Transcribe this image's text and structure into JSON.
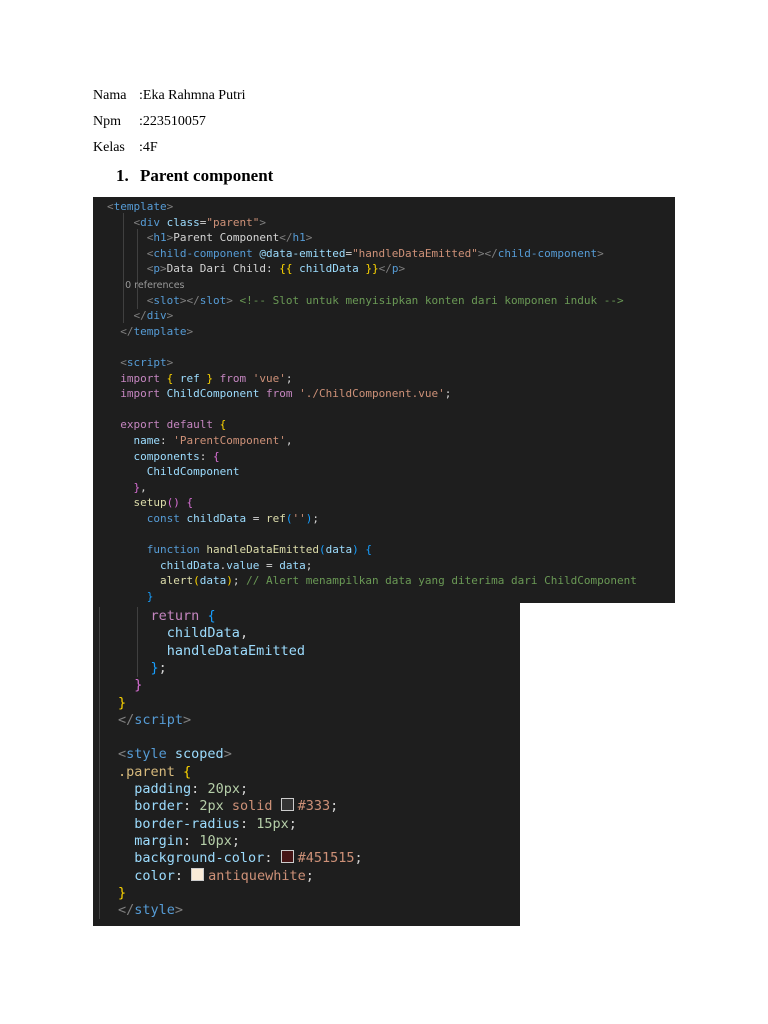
{
  "student": {
    "nama_label": "Nama",
    "nama_value": ":Eka Rahmna Putri",
    "npm_label": "Npm",
    "npm_value": ":223510057",
    "kelas_label": "Kelas",
    "kelas_value": ":4F"
  },
  "section": {
    "number": "1.",
    "title": "Parent component"
  },
  "code_top": {
    "lines": [
      [
        [
          "g",
          "<"
        ],
        [
          "t",
          "template"
        ],
        [
          "g",
          ">"
        ]
      ],
      [
        [
          "w",
          "    "
        ],
        [
          "g",
          "<"
        ],
        [
          "t",
          "div"
        ],
        [
          "w",
          " "
        ],
        [
          "a",
          "class"
        ],
        [
          "w",
          "="
        ],
        [
          "s",
          "\"parent\""
        ],
        [
          "g",
          ">"
        ]
      ],
      [
        [
          "w",
          "      "
        ],
        [
          "g",
          "<"
        ],
        [
          "t",
          "h1"
        ],
        [
          "g",
          ">"
        ],
        [
          "w",
          "Parent Component"
        ],
        [
          "g",
          "</"
        ],
        [
          "t",
          "h1"
        ],
        [
          "g",
          ">"
        ]
      ],
      [
        [
          "w",
          "      "
        ],
        [
          "g",
          "<"
        ],
        [
          "t",
          "child-component"
        ],
        [
          "w",
          " "
        ],
        [
          "a",
          "@data-emitted"
        ],
        [
          "w",
          "="
        ],
        [
          "s",
          "\"handleDataEmitted\""
        ],
        [
          "g",
          "></"
        ],
        [
          "t",
          "child-component"
        ],
        [
          "g",
          ">"
        ]
      ],
      [
        [
          "w",
          "      "
        ],
        [
          "g",
          "<"
        ],
        [
          "t",
          "p"
        ],
        [
          "g",
          ">"
        ],
        [
          "w",
          "Data Dari Child: "
        ],
        [
          "y",
          "{{"
        ],
        [
          "w",
          " "
        ],
        [
          "a",
          "childData"
        ],
        [
          "w",
          " "
        ],
        [
          "y",
          "}}"
        ],
        [
          "g",
          "</"
        ],
        [
          "t",
          "p"
        ],
        [
          "g",
          ">"
        ]
      ],
      [
        [
          "ref",
          "      0 references"
        ]
      ],
      [
        [
          "w",
          "      "
        ],
        [
          "g",
          "<"
        ],
        [
          "t",
          "slot"
        ],
        [
          "g",
          "></"
        ],
        [
          "t",
          "slot"
        ],
        [
          "g",
          ">"
        ],
        [
          "w",
          " "
        ],
        [
          "c",
          "<!-- Slot untuk menyisipkan konten dari komponen induk -->"
        ]
      ],
      [
        [
          "w",
          "    "
        ],
        [
          "g",
          "</"
        ],
        [
          "t",
          "div"
        ],
        [
          "g",
          ">"
        ]
      ],
      [
        [
          "w",
          "  "
        ],
        [
          "g",
          "</"
        ],
        [
          "t",
          "template"
        ],
        [
          "g",
          ">"
        ]
      ],
      [],
      [
        [
          "w",
          "  "
        ],
        [
          "g",
          "<"
        ],
        [
          "t",
          "script"
        ],
        [
          "g",
          ">"
        ]
      ],
      [
        [
          "w",
          "  "
        ],
        [
          "k",
          "import"
        ],
        [
          "w",
          " "
        ],
        [
          "y",
          "{"
        ],
        [
          "w",
          " "
        ],
        [
          "a",
          "ref"
        ],
        [
          "w",
          " "
        ],
        [
          "y",
          "}"
        ],
        [
          "w",
          " "
        ],
        [
          "k",
          "from"
        ],
        [
          "w",
          " "
        ],
        [
          "s",
          "'vue'"
        ],
        [
          "w",
          ";"
        ]
      ],
      [
        [
          "w",
          "  "
        ],
        [
          "k",
          "import"
        ],
        [
          "w",
          " "
        ],
        [
          "a",
          "ChildComponent"
        ],
        [
          "w",
          " "
        ],
        [
          "k",
          "from"
        ],
        [
          "w",
          " "
        ],
        [
          "s",
          "'./ChildComponent.vue'"
        ],
        [
          "w",
          ";"
        ]
      ],
      [],
      [
        [
          "w",
          "  "
        ],
        [
          "k",
          "export"
        ],
        [
          "w",
          " "
        ],
        [
          "k",
          "default"
        ],
        [
          "w",
          " "
        ],
        [
          "y",
          "{"
        ]
      ],
      [
        [
          "w",
          "    "
        ],
        [
          "a",
          "name"
        ],
        [
          "w",
          ": "
        ],
        [
          "s",
          "'ParentComponent'"
        ],
        [
          "w",
          ","
        ]
      ],
      [
        [
          "w",
          "    "
        ],
        [
          "a",
          "components"
        ],
        [
          "w",
          ": "
        ],
        [
          "p",
          "{"
        ]
      ],
      [
        [
          "w",
          "      "
        ],
        [
          "a",
          "ChildComponent"
        ]
      ],
      [
        [
          "w",
          "    "
        ],
        [
          "p",
          "}"
        ],
        [
          "w",
          ","
        ]
      ],
      [
        [
          "w",
          "    "
        ],
        [
          "f",
          "setup"
        ],
        [
          "p",
          "()"
        ],
        [
          "w",
          " "
        ],
        [
          "p",
          "{"
        ]
      ],
      [
        [
          "w",
          "      "
        ],
        [
          "t",
          "const"
        ],
        [
          "w",
          " "
        ],
        [
          "a",
          "childData"
        ],
        [
          "w",
          " = "
        ],
        [
          "f",
          "ref"
        ],
        [
          "b",
          "("
        ],
        [
          "s",
          "''"
        ],
        [
          "b",
          ")"
        ],
        [
          "w",
          ";"
        ]
      ],
      [],
      [
        [
          "w",
          "      "
        ],
        [
          "t",
          "function"
        ],
        [
          "w",
          " "
        ],
        [
          "f",
          "handleDataEmitted"
        ],
        [
          "b",
          "("
        ],
        [
          "a",
          "data"
        ],
        [
          "b",
          ")"
        ],
        [
          "w",
          " "
        ],
        [
          "b",
          "{"
        ]
      ],
      [
        [
          "w",
          "        "
        ],
        [
          "a",
          "childData"
        ],
        [
          "w",
          "."
        ],
        [
          "a",
          "value"
        ],
        [
          "w",
          " = "
        ],
        [
          "a",
          "data"
        ],
        [
          "w",
          ";"
        ]
      ],
      [
        [
          "w",
          "        "
        ],
        [
          "f",
          "alert"
        ],
        [
          "y",
          "("
        ],
        [
          "a",
          "data"
        ],
        [
          "y",
          ")"
        ],
        [
          "w",
          "; "
        ],
        [
          "c",
          "// Alert menampilkan data yang diterima dari ChildComponent"
        ]
      ],
      [
        [
          "w",
          "      "
        ],
        [
          "b",
          "}"
        ]
      ]
    ]
  },
  "code_bottom": {
    "lines": [
      [
        [
          "w",
          "    "
        ],
        [
          "k",
          "return"
        ],
        [
          "w",
          " "
        ],
        [
          "b",
          "{"
        ]
      ],
      [
        [
          "w",
          "      "
        ],
        [
          "a",
          "childData"
        ],
        [
          "w",
          ","
        ]
      ],
      [
        [
          "w",
          "      "
        ],
        [
          "a",
          "handleDataEmitted"
        ]
      ],
      [
        [
          "w",
          "    "
        ],
        [
          "b",
          "}"
        ],
        [
          "w",
          ";"
        ]
      ],
      [
        [
          "w",
          "  "
        ],
        [
          "p",
          "}"
        ]
      ],
      [
        [
          "y",
          "}"
        ]
      ],
      [
        [
          "g",
          "</"
        ],
        [
          "t",
          "script"
        ],
        [
          "g",
          ">"
        ]
      ],
      [],
      [
        [
          "g",
          "<"
        ],
        [
          "t",
          "style"
        ],
        [
          "w",
          " "
        ],
        [
          "a",
          "scoped"
        ],
        [
          "g",
          ">"
        ]
      ],
      [
        [
          "sel",
          ".parent"
        ],
        [
          "w",
          " "
        ],
        [
          "y",
          "{"
        ]
      ],
      [
        [
          "w",
          "  "
        ],
        [
          "a",
          "padding"
        ],
        [
          "w",
          ": "
        ],
        [
          "n",
          "20px"
        ],
        [
          "w",
          ";"
        ]
      ],
      [
        [
          "w",
          "  "
        ],
        [
          "a",
          "border"
        ],
        [
          "w",
          ": "
        ],
        [
          "n",
          "2px"
        ],
        [
          "w",
          " "
        ],
        [
          "s",
          "solid"
        ],
        [
          "w",
          " "
        ],
        [
          "sw",
          "#333333"
        ],
        [
          "s",
          "#333"
        ],
        [
          "w",
          ";"
        ]
      ],
      [
        [
          "w",
          "  "
        ],
        [
          "a",
          "border-radius"
        ],
        [
          "w",
          ": "
        ],
        [
          "n",
          "15px"
        ],
        [
          "w",
          ";"
        ]
      ],
      [
        [
          "w",
          "  "
        ],
        [
          "a",
          "margin"
        ],
        [
          "w",
          ": "
        ],
        [
          "n",
          "10px"
        ],
        [
          "w",
          ";"
        ]
      ],
      [
        [
          "w",
          "  "
        ],
        [
          "a",
          "background-color"
        ],
        [
          "w",
          ": "
        ],
        [
          "sw",
          "#451515"
        ],
        [
          "s",
          "#451515"
        ],
        [
          "w",
          ";"
        ]
      ],
      [
        [
          "w",
          "  "
        ],
        [
          "a",
          "color"
        ],
        [
          "w",
          ": "
        ],
        [
          "sw",
          "#faebd7"
        ],
        [
          "s",
          "antiquewhite"
        ],
        [
          "w",
          ";"
        ]
      ],
      [
        [
          "y",
          "}"
        ]
      ],
      [
        [
          "g",
          "</"
        ],
        [
          "t",
          "style"
        ],
        [
          "g",
          ">"
        ]
      ]
    ]
  }
}
